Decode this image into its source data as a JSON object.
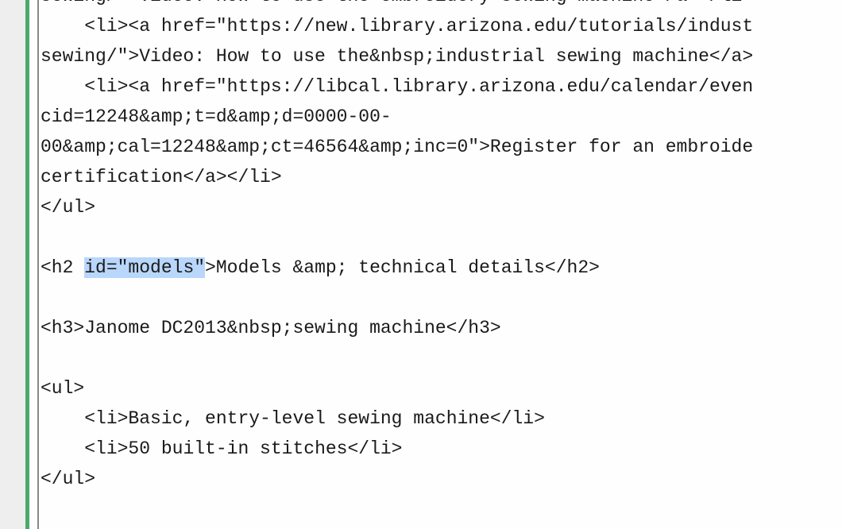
{
  "lines": {
    "l1a": "sewing/\">Video: How to use the embroidery sewing machine</a></li>",
    "l2_indent": "    ",
    "l2_tag_open": "<li><a href=\"",
    "l2_url": "https://new.library.arizona.edu/tutorials/indust",
    "l3": "sewing/\">Video: How to use the&nbsp;industrial sewing machine</a>",
    "l4_indent": "    ",
    "l4_tag_open": "<li><a href=\"",
    "l4_url": "https://libcal.library.arizona.edu/calendar/even",
    "l5": "cid=12248&amp;t=d&amp;d=0000-00-",
    "l6": "00&amp;cal=12248&amp;ct=46564&amp;inc=0\">Register for an embroide",
    "l7": "certification</a></li>",
    "l8": "</ul>",
    "blank": "",
    "h2_open": "<h2 ",
    "h2_attr": "id=\"models\"",
    "h2_rest": ">Models &amp; technical details</h2>",
    "h3": "<h3>Janome DC2013&nbsp;sewing machine</h3>",
    "ul_open": "<ul>",
    "li1_indent": "    ",
    "li1": "<li>Basic, entry-level sewing machine</li>",
    "li2_indent": "    ",
    "li2": "<li>50 built-in stitches</li>",
    "ul_close": "</ul>"
  }
}
